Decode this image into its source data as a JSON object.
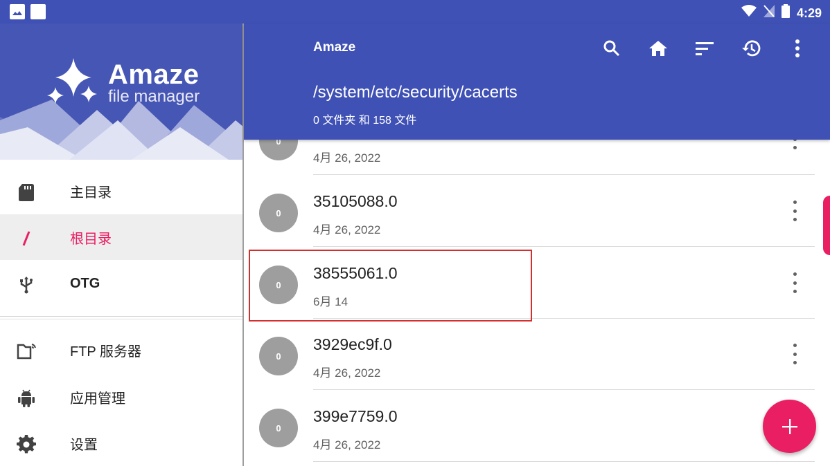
{
  "status_bar": {
    "time": "4:29",
    "icons": [
      "image-notification-icon",
      "square-notification-icon",
      "wifi-icon",
      "no-sim-icon",
      "battery-icon"
    ]
  },
  "drawer": {
    "logo": {
      "title": "Amaze",
      "subtitle": "file manager"
    },
    "items": [
      {
        "label": "主目录",
        "icon": "sd-card-icon",
        "active": false
      },
      {
        "label": "根目录",
        "icon": "slash-icon",
        "active": true
      },
      {
        "label": "OTG",
        "icon": "usb-icon",
        "active": false
      },
      {
        "label": "FTP 服务器",
        "icon": "ftp-folder-icon",
        "active": false
      },
      {
        "label": "应用管理",
        "icon": "android-icon",
        "active": false
      },
      {
        "label": "设置",
        "icon": "gear-icon",
        "active": false
      }
    ]
  },
  "appbar": {
    "title": "Amaze",
    "path": "/system/etc/security/cacerts",
    "count": "0 文件夹 和 158 文件",
    "actions": [
      "search-icon",
      "home-icon",
      "sort-icon",
      "history-icon",
      "more-vert-icon"
    ]
  },
  "files": [
    {
      "avatar": "0",
      "name": "",
      "date": "4月 26, 2022"
    },
    {
      "avatar": "0",
      "name": "35105088.0",
      "date": "4月 26, 2022"
    },
    {
      "avatar": "0",
      "name": "38555061.0",
      "date": "6月 14"
    },
    {
      "avatar": "0",
      "name": "3929ec9f.0",
      "date": "4月 26, 2022"
    },
    {
      "avatar": "0",
      "name": "399e7759.0",
      "date": "4月 26, 2022"
    }
  ],
  "fab": {
    "label": "+"
  },
  "colors": {
    "primary": "#3f51b5",
    "accent": "#e91e63",
    "avatar": "#9e9e9e",
    "highlight": "#d32f2f"
  }
}
